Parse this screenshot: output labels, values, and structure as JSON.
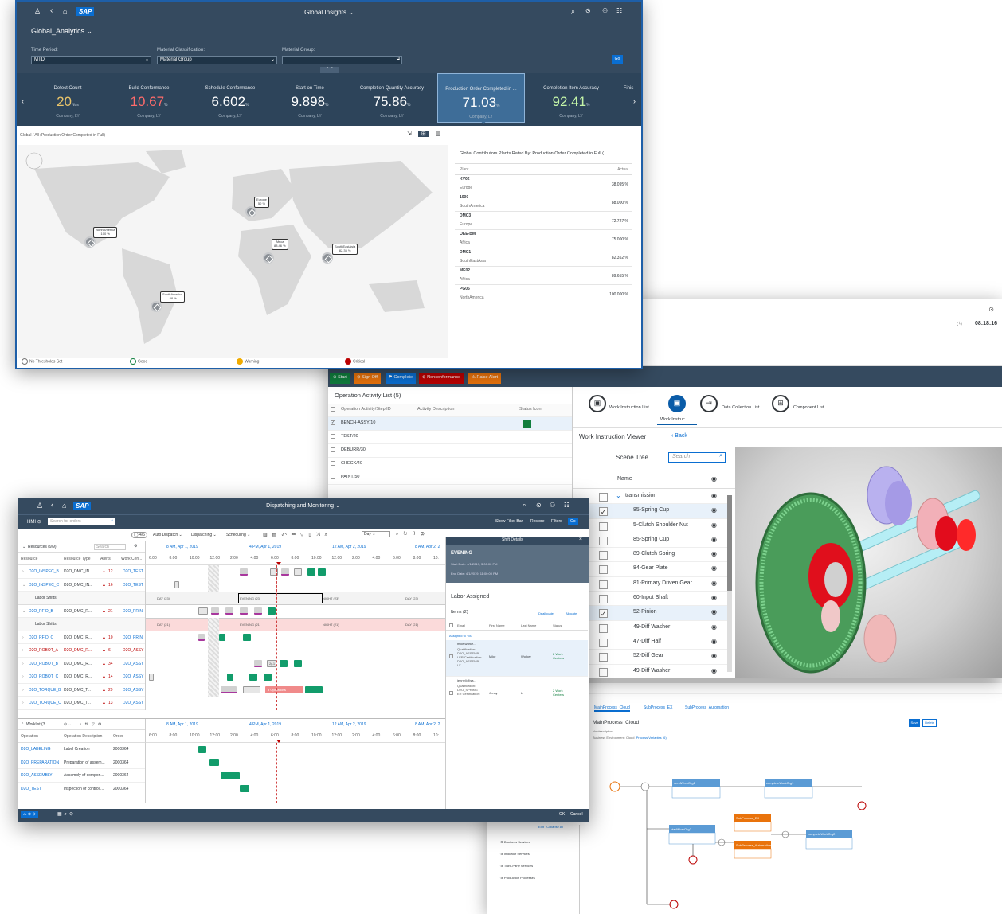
{
  "colors": {
    "shell": "#354a5f",
    "brand": "#0a6ed1",
    "good": "#107e3e",
    "critical": "#bb0000",
    "warning": "#e9730c",
    "green_bar": "#129c6b"
  },
  "insights": {
    "logo": "SAP",
    "title": "Global Insights",
    "page_title": "Global_Analytics",
    "filters": {
      "time_period_label": "Time Period:",
      "time_period_value": "MTD",
      "material_class_label": "Material Classification:",
      "material_class_value": "Material Group",
      "material_group_label": "Material Group:",
      "go": "Go"
    },
    "tiles": [
      {
        "label": "Defect Count",
        "value": "20",
        "unit": "Nos",
        "sub": "Company, LY",
        "color": "#e9c46a"
      },
      {
        "label": "Build Conformance",
        "value": "10.67",
        "unit": "%",
        "sub": "Company, LY",
        "color": "#ff6b6b"
      },
      {
        "label": "Schedule Conformance",
        "value": "6.602",
        "unit": "%",
        "sub": "Company, LY",
        "color": "#ffffff"
      },
      {
        "label": "Start on Time",
        "value": "9.898",
        "unit": "%",
        "sub": "Company, LY",
        "color": "#ffffff"
      },
      {
        "label": "Completion Quantity Accuracy",
        "value": "75.86",
        "unit": "%",
        "sub": "Company, LY",
        "color": "#ffffff"
      },
      {
        "label": "Production Order Completed in ...",
        "value": "71.03",
        "unit": "%",
        "sub": "Company, LY",
        "color": "#ffffff"
      },
      {
        "label": "Completion Item Accuracy",
        "value": "92.41",
        "unit": "%",
        "sub": "Company, LY",
        "color": "#c4f5a8"
      },
      {
        "label": "Finis",
        "value": "",
        "unit": "",
        "sub": "",
        "color": "#ffffff"
      }
    ],
    "breadcrumb": "Global / All (Production Order Completed in Full)",
    "map_pins": [
      {
        "label": "NorthAmerica",
        "value": "100 %"
      },
      {
        "label": "Europe",
        "value": "50 %"
      },
      {
        "label": "Africa",
        "value": "88.46 %"
      },
      {
        "label": "SouthEastAsia",
        "value": "82.35 %"
      },
      {
        "label": "SouthAmerica",
        "value": "-88 %"
      }
    ],
    "table": {
      "title": "Global Contributors Plants Rated By: Production Order Completed in Full (...",
      "col_plant": "Plant",
      "col_actual": "Actual",
      "rows": [
        {
          "plant": "KV02",
          "region": "Europe",
          "actual": "38.095 %"
        },
        {
          "plant": "1000",
          "region": "SouthAmerica",
          "actual": "88.000 %"
        },
        {
          "plant": "DMC3",
          "region": "Europe",
          "actual": "72.727 %"
        },
        {
          "plant": "OEE-BM",
          "region": "Africa",
          "actual": "75.000 %"
        },
        {
          "plant": "DMC1",
          "region": "SouthEastAsia",
          "actual": "82.352 %"
        },
        {
          "plant": "ME02",
          "region": "Africa",
          "actual": "89.655 %"
        },
        {
          "plant": "PG05",
          "region": "NorthAmerica",
          "actual": "100.000 %"
        }
      ]
    },
    "legend": {
      "none": "No Thresholds Set",
      "good": "Good",
      "warning": "Warning",
      "critical": "Critical"
    }
  },
  "pod": {
    "clock": "08:18:16",
    "actions": [
      "Start",
      "Sign Off",
      "Complete",
      "Nonconformance",
      "Raise Alert"
    ],
    "list_title": "Operation Activity List (5)",
    "col_op": "Operation Activity/Step ID",
    "col_desc": "Activity Description",
    "col_status": "Status Icon",
    "ops": [
      "BENCH-ASSY/10",
      "TEST/20",
      "DEBURR/30",
      "CHECK/40",
      "PAINT/50"
    ],
    "tabs": [
      "Work Instruction List",
      "Work Instruc...",
      "Data Collection List",
      "Component List"
    ],
    "viewer_title": "Work Instruction Viewer",
    "back": "Back",
    "scene_tree": "Scene Tree",
    "search_placeholder": "Search",
    "name_col": "Name",
    "parts": [
      {
        "name": "transmission",
        "checked": false,
        "root": true
      },
      {
        "name": "85-Spring Cup",
        "checked": true
      },
      {
        "name": "5-Clutch Shoulder Nut",
        "checked": false
      },
      {
        "name": "85-Spring Cup",
        "checked": false
      },
      {
        "name": "89-Clutch Spring",
        "checked": false
      },
      {
        "name": "84-Gear Plate",
        "checked": false
      },
      {
        "name": "81-Primary Driven Gear",
        "checked": false
      },
      {
        "name": "60-Input Shaft",
        "checked": false
      },
      {
        "name": "52-Pinion",
        "checked": true
      },
      {
        "name": "49-Diff Washer",
        "checked": false
      },
      {
        "name": "47-Diff Half",
        "checked": false
      },
      {
        "name": "52-Diff Gear",
        "checked": false
      },
      {
        "name": "49-Diff Washer",
        "checked": false
      }
    ]
  },
  "modeler": {
    "tabs": [
      "MainProcess_Cloud",
      "SubProcess_EX",
      "SubProcess_Automation"
    ],
    "title": "MainProcess_Cloud",
    "desc": "No description",
    "env": "Business Environment: Cloud",
    "vars": "Process Variables (6)",
    "save": "Save",
    "delete": "Delete",
    "tree": [
      "Business Services",
      "Indicator Services",
      "Third-Party Services",
      "Production Processes"
    ],
    "edit": "Edit",
    "collapse": "Collapse All",
    "nodes": [
      "sendWorkOrg1",
      "completeWorkOrg1",
      "startWorkOrg2",
      "SubProcess_EX",
      "SubProcess_Automation",
      "completeWorkOrg2"
    ]
  },
  "dispatch": {
    "logo": "SAP",
    "title": "Dispatching and Monitoring",
    "variant": "HMI",
    "search_placeholder": "Search for orders",
    "show_filter_bar": "Show Filter Bar",
    "restore": "Restore",
    "filters": "Filters",
    "go": "Go",
    "toolbar": [
      "Auto Dispatch",
      "Dispatching",
      "Scheduling"
    ],
    "view": "Day",
    "resources_title": "Resources (9/9)",
    "search": "Search",
    "cols": [
      "Resource",
      "Resource Type",
      "Alerts",
      "Work Cen..."
    ],
    "dates": [
      "8 AM, Apr 1, 2019",
      "4 PM, Apr 1, 2019",
      "12 AM, Apr 2, 2019",
      "8 AM, Apr 2, 2"
    ],
    "hours": [
      "6:00",
      "8:00",
      "10:00",
      "12:00",
      "2:00",
      "4:00",
      "6:00",
      "8:00",
      "10:00",
      "12:00",
      "2:00",
      "4:00",
      "6:00",
      "8:00",
      "10:"
    ],
    "resources": [
      {
        "name": "D2O_INSPEC_B",
        "type": "D2O_DMC_IN...",
        "alerts": "12",
        "wc": "D2O_TEST",
        "red": false
      },
      {
        "name": "D2O_INSPEC_C",
        "type": "D2O_DMC_IN...",
        "alerts": "16",
        "wc": "D2O_TEST",
        "red": false
      },
      {
        "name": "Labor Shifts",
        "shift": true
      },
      {
        "name": "D2O_RFID_B",
        "type": "D2O_DMC_R...",
        "alerts": "21",
        "wc": "D2O_PRIN",
        "red": false
      },
      {
        "name": "Labor Shifts",
        "shift": true
      },
      {
        "name": "D2O_RFID_C",
        "type": "D2O_DMC_R...",
        "alerts": "10",
        "wc": "D2O_PRIN",
        "red": false
      },
      {
        "name": "D2O_ROBOT_A",
        "type": "D2O_DMC_R...",
        "alerts": "6",
        "wc": "D2O_ASSY",
        "red": true
      },
      {
        "name": "D2O_ROBOT_B",
        "type": "D2O_DMC_R...",
        "alerts": "34",
        "wc": "D2O_ASSY",
        "red": false
      },
      {
        "name": "D2O_ROBOT_C",
        "type": "D2O_DMC_R...",
        "alerts": "14",
        "wc": "D2O_ASSY",
        "red": false
      },
      {
        "name": "D2O_TORQUE_B",
        "type": "D2O_DMC_T...",
        "alerts": "29",
        "wc": "D2O_ASSY",
        "red": false
      },
      {
        "name": "D2O_TORQUE_C",
        "type": "D2O_DMC_T...",
        "alerts": "13",
        "wc": "D2O_ASSY",
        "red": false
      }
    ],
    "shift_labels": [
      "DAY (23)",
      "EVENING (23)",
      "NIGHT (23)",
      "DAY (23)",
      "DAY (21)",
      "EVENING (21)",
      "NIGHT (21)",
      "DAY (21)"
    ],
    "ops_label": "3 Operations",
    "block_label": "2(-1",
    "worklist_title": "Worklist (3...",
    "worklist_cols": [
      "Operation",
      "Operation Description",
      "Order"
    ],
    "worklist": [
      {
        "op": "D2O_LABELING",
        "desc": "Label Creation",
        "order": "2000364"
      },
      {
        "op": "D2O_PREPARATION",
        "desc": "Preparation of assem...",
        "order": "2000364"
      },
      {
        "op": "D2O_ASSEMBLY",
        "desc": "Assembly of compon...",
        "order": "2000364"
      },
      {
        "op": "D2O_TEST",
        "desc": "Inspection of control ...",
        "order": "2000364"
      }
    ],
    "shift": {
      "title": "Shift Details",
      "name": "EVENING",
      "start": "Start Date: 4/1/2019, 3:00:00 PM",
      "end": "End Date: 4/1/2019, 11:00:00 PM",
      "labor_title": "Labor Assigned",
      "items": "Items (2)",
      "deallocate": "Deallocate",
      "allocate": "Allocate",
      "cols": [
        "Email",
        "First Name",
        "Last Name",
        "Status"
      ],
      "group": "Assigned to You",
      "people": [
        {
          "email": "mike.worke...",
          "qual": "Qualification: D2O_ASSEMB LER Certification: D2O_ASSEMB LY",
          "first": "Mike",
          "last": "Worker",
          "status": "2 Work Centers"
        },
        {
          "email": "jenny.li@sa...",
          "qual": "Qualification: D2O_SPRING ER Certification:",
          "first": "Jenny",
          "last": "Li",
          "status": "2 Work Centers"
        }
      ]
    },
    "ok": "OK",
    "cancel": "Cancel"
  }
}
